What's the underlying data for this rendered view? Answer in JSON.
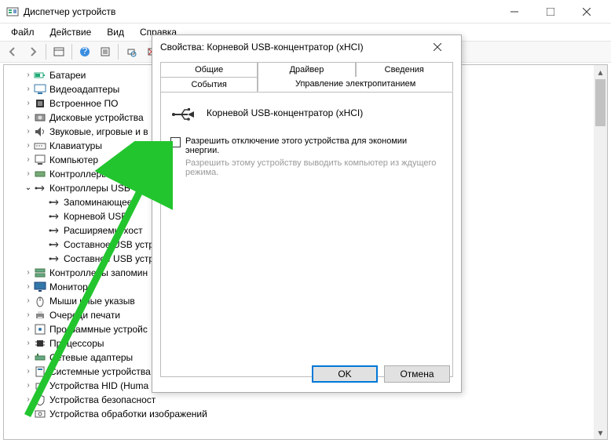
{
  "window": {
    "title": "Диспетчер устройств"
  },
  "menu": {
    "file": "Файл",
    "action": "Действие",
    "view": "Вид",
    "help": "Справка"
  },
  "tree": {
    "items": [
      {
        "label": "Батареи",
        "icon": "battery",
        "depth": 1,
        "chev": ">"
      },
      {
        "label": "Видеоадаптеры",
        "icon": "display",
        "depth": 1,
        "chev": ">"
      },
      {
        "label": "Встроенное ПО",
        "icon": "chip",
        "depth": 1,
        "chev": ">"
      },
      {
        "label": "Дисковые устройства",
        "icon": "disk",
        "depth": 1,
        "chev": ">"
      },
      {
        "label": "Звуковые, игровые и в",
        "icon": "audio",
        "depth": 1,
        "chev": ">"
      },
      {
        "label": "Клавиатуры",
        "icon": "keyboard",
        "depth": 1,
        "chev": ">"
      },
      {
        "label": "Компьютер",
        "icon": "pc",
        "depth": 1,
        "chev": ">"
      },
      {
        "label": "Контроллеры IDE ATA/",
        "icon": "ide",
        "depth": 1,
        "chev": ">"
      },
      {
        "label": "Контроллеры USB",
        "icon": "usb",
        "depth": 1,
        "chev": "v"
      },
      {
        "label": "Запоминающее",
        "icon": "usb",
        "depth": 2,
        "chev": ""
      },
      {
        "label": "Корневой USB-",
        "icon": "usb",
        "depth": 2,
        "chev": ""
      },
      {
        "label": "Расширяемы хост",
        "icon": "usb",
        "depth": 2,
        "chev": ""
      },
      {
        "label": "Составное USB устр",
        "icon": "usb",
        "depth": 2,
        "chev": ""
      },
      {
        "label": "Составное USB устр",
        "icon": "usb",
        "depth": 2,
        "chev": ""
      },
      {
        "label": "Контроллеры запомин",
        "icon": "storage",
        "depth": 1,
        "chev": ">"
      },
      {
        "label": "Мониторы",
        "icon": "monitor",
        "depth": 1,
        "chev": ">"
      },
      {
        "label": "Мыши иные указыв",
        "icon": "mouse",
        "depth": 1,
        "chev": ">"
      },
      {
        "label": "Очереди печати",
        "icon": "printer",
        "depth": 1,
        "chev": ">"
      },
      {
        "label": "Программные устройс",
        "icon": "soft",
        "depth": 1,
        "chev": ">"
      },
      {
        "label": "Процессоры",
        "icon": "cpu",
        "depth": 1,
        "chev": ">"
      },
      {
        "label": "Сетевые адаптеры",
        "icon": "net",
        "depth": 1,
        "chev": ">"
      },
      {
        "label": "Системные устройства",
        "icon": "sys",
        "depth": 1,
        "chev": ">"
      },
      {
        "label": "Устройства HID (Huma",
        "icon": "hid",
        "depth": 1,
        "chev": ">"
      },
      {
        "label": "Устройства безопасност",
        "icon": "sec",
        "depth": 1,
        "chev": ">"
      },
      {
        "label": "Устройства обработки изображений",
        "icon": "img",
        "depth": 1,
        "chev": ">"
      }
    ]
  },
  "dialog": {
    "title": "Свойства: Корневой USB-концентратор (xHCI)",
    "tabs": {
      "general": "Общие",
      "driver": "Драйвер",
      "details": "Сведения",
      "events": "События",
      "power": "Управление электропитанием"
    },
    "device_name": "Корневой USB-концентратор (xHCI)",
    "checkbox_label": "Разрешить отключение этого устройства для экономии энергии.",
    "checkbox_sub": "Разрешить этому устройству выводить компьютер из ждущего режима.",
    "ok": "OK",
    "cancel": "Отмена"
  }
}
